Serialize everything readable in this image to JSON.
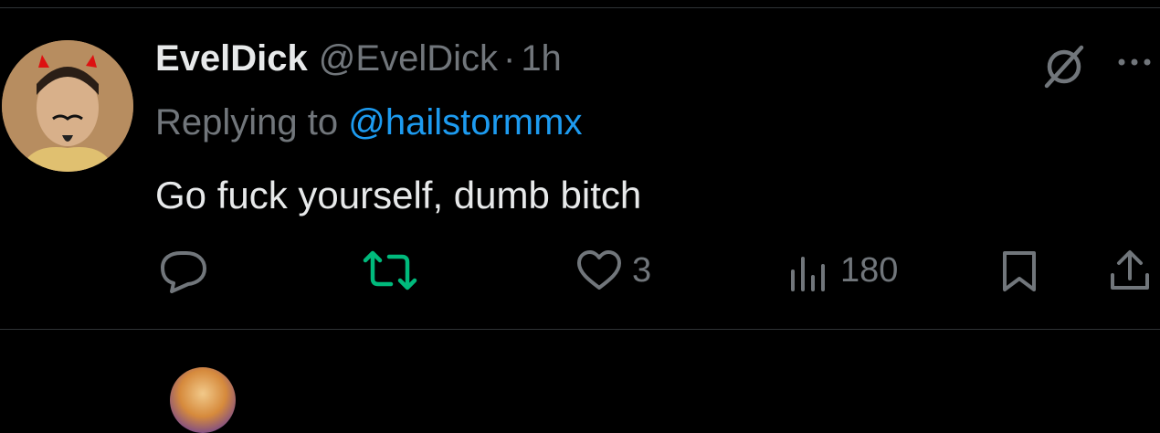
{
  "tweet": {
    "display_name": "EvelDick",
    "handle": "@EvelDick",
    "separator": "·",
    "time": "1h",
    "reply_prefix": "Replying to",
    "reply_handle": "@hailstormmx",
    "text": "Go fuck yourself, dumb bitch",
    "avatar_icon": "profile-photo",
    "header_icons": [
      "grok-icon",
      "more-icon"
    ]
  },
  "actions": {
    "reply": {
      "icon": "reply-icon",
      "count": ""
    },
    "repost": {
      "icon": "repost-icon",
      "count": "",
      "active_color": "#00ba7c"
    },
    "like": {
      "icon": "heart-icon",
      "count": "3"
    },
    "views": {
      "icon": "views-icon",
      "count": "180"
    },
    "bookmark": {
      "icon": "bookmark-icon"
    },
    "share": {
      "icon": "share-icon"
    }
  },
  "colors": {
    "background": "#000000",
    "text_primary": "#e7e9ea",
    "text_secondary": "#71767b",
    "link": "#1d9bf0",
    "repost_active": "#00ba7c",
    "divider": "#2f3336"
  }
}
